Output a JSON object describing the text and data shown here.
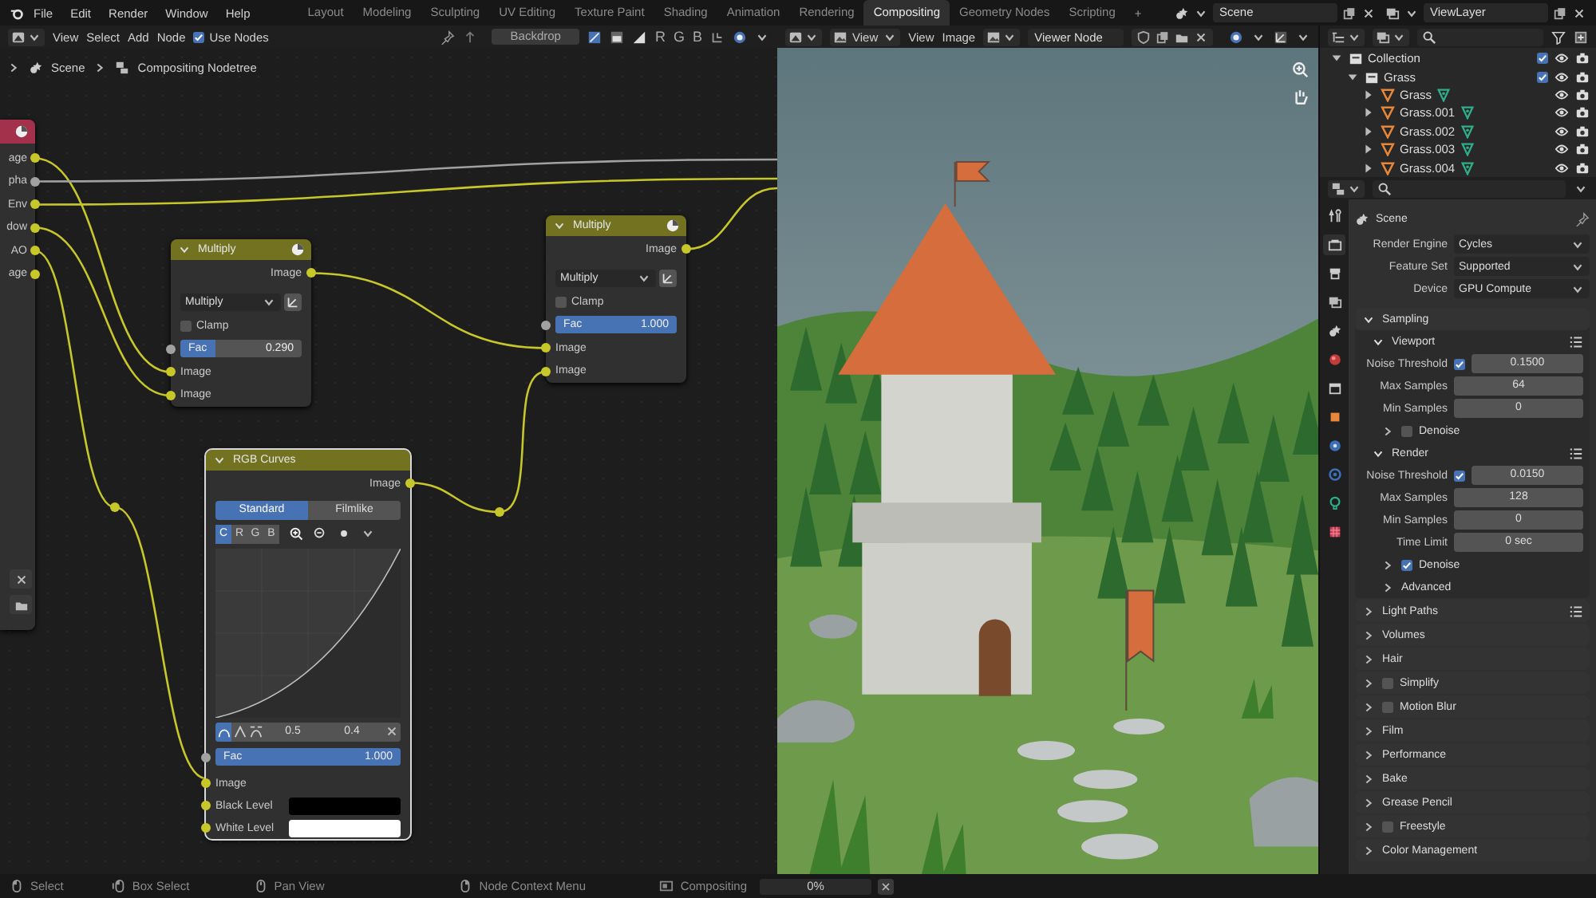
{
  "topbar": {
    "menus": [
      "File",
      "Edit",
      "Render",
      "Window",
      "Help"
    ],
    "workspaces": [
      {
        "label": "Layout",
        "selected": false
      },
      {
        "label": "Modeling",
        "selected": false
      },
      {
        "label": "Sculpting",
        "selected": false
      },
      {
        "label": "UV Editing",
        "selected": false
      },
      {
        "label": "Texture Paint",
        "selected": false
      },
      {
        "label": "Shading",
        "selected": false
      },
      {
        "label": "Animation",
        "selected": false
      },
      {
        "label": "Rendering",
        "selected": false
      },
      {
        "label": "Compositing",
        "selected": true
      },
      {
        "label": "Geometry Nodes",
        "selected": false
      },
      {
        "label": "Scripting",
        "selected": false
      }
    ],
    "add_workspace": "+",
    "scene": "Scene",
    "view_layer": "ViewLayer"
  },
  "node_editor": {
    "menus": [
      "View",
      "Select",
      "Add",
      "Node"
    ],
    "use_nodes": {
      "label": "Use Nodes",
      "checked": true
    },
    "backdrop": "Backdrop",
    "backdrop_channels": [
      "R",
      "G",
      "B"
    ],
    "breadcrumb": [
      "Scene",
      "Compositing Nodetree"
    ],
    "render_layers_node": {
      "sockets": [
        "age",
        "pha",
        "Env",
        "dow",
        "AO",
        "age"
      ]
    },
    "nodes": [
      {
        "kind": "mix",
        "title": "Multiply",
        "output": "Image",
        "blend": "Multiply",
        "clamp": {
          "label": "Clamp",
          "checked": false
        },
        "fac": {
          "label": "Fac",
          "value": "0.290",
          "level": 0.29
        },
        "inputs": [
          "Image",
          "Image"
        ]
      },
      {
        "kind": "mix",
        "title": "Multiply",
        "output": "Image",
        "blend": "Multiply",
        "clamp": {
          "label": "Clamp",
          "checked": false
        },
        "fac": {
          "label": "Fac",
          "value": "1.000",
          "level": 1
        },
        "inputs": [
          "Image",
          "Image"
        ]
      },
      {
        "kind": "curves",
        "title": "RGB Curves",
        "output": "Image",
        "modes": [
          {
            "label": "Standard",
            "selected": true
          },
          {
            "label": "Filmlike",
            "selected": false
          }
        ],
        "channels": [
          {
            "label": "C",
            "selected": true
          },
          {
            "label": "R",
            "selected": false
          },
          {
            "label": "G",
            "selected": false
          },
          {
            "label": "B",
            "selected": false
          }
        ],
        "point": [
          "0.5",
          "0.4"
        ],
        "fac": {
          "label": "Fac",
          "value": "1.000",
          "level": 1
        },
        "inputs": [
          {
            "kind": "socket",
            "label": "Image"
          },
          {
            "kind": "color",
            "label": "Black Level",
            "color": "#000000"
          },
          {
            "kind": "color",
            "label": "White Level",
            "color": "#ffffff"
          }
        ]
      }
    ]
  },
  "image_editor": {
    "view_dropdown": "View",
    "menus": [
      "View",
      "Image"
    ],
    "image": "Viewer Node"
  },
  "outliner": {
    "tree": [
      {
        "kind": "collection",
        "name": "Collection",
        "expanded": true,
        "checked": true,
        "children": [
          {
            "kind": "collection",
            "name": "Grass",
            "expanded": true,
            "checked": true,
            "children": [
              {
                "kind": "object",
                "name": "Grass",
                "expanded": false
              },
              {
                "kind": "object",
                "name": "Grass.001",
                "expanded": false
              },
              {
                "kind": "object",
                "name": "Grass.002",
                "expanded": false
              },
              {
                "kind": "object",
                "name": "Grass.003",
                "expanded": false
              },
              {
                "kind": "object",
                "name": "Grass.004",
                "expanded": false
              }
            ]
          }
        ]
      }
    ]
  },
  "properties": {
    "tabs": [
      {
        "kind": "tool",
        "selected": false
      },
      {
        "kind": "render",
        "selected": true
      },
      {
        "kind": "output",
        "selected": false
      },
      {
        "kind": "view_layer",
        "selected": false
      },
      {
        "kind": "scene",
        "selected": false
      },
      {
        "kind": "world",
        "selected": false
      },
      {
        "kind": "collection",
        "selected": false
      },
      {
        "kind": "object",
        "selected": false
      },
      {
        "kind": "modifier",
        "selected": false
      },
      {
        "kind": "physics",
        "selected": false
      },
      {
        "kind": "data",
        "selected": false
      },
      {
        "kind": "texture",
        "selected": false
      }
    ],
    "context": "Scene",
    "fields": [
      {
        "label": "Render Engine",
        "value": "Cycles"
      },
      {
        "label": "Feature Set",
        "value": "Supported"
      },
      {
        "label": "Device",
        "value": "GPU Compute"
      }
    ],
    "panels": [
      {
        "kind": "panel",
        "title": "Sampling",
        "expanded": true,
        "children": [
          {
            "kind": "panel",
            "title": "Viewport",
            "expanded": true,
            "presets": true,
            "children": [
              {
                "kind": "toggle_number",
                "label": "Noise Threshold",
                "checked": true,
                "value": "0.1500"
              },
              {
                "kind": "number",
                "label": "Max Samples",
                "value": "64"
              },
              {
                "kind": "number",
                "label": "Min Samples",
                "value": "0"
              },
              {
                "kind": "panel",
                "title": "Denoise",
                "expanded": false,
                "checked": false
              }
            ]
          },
          {
            "kind": "panel",
            "title": "Render",
            "expanded": true,
            "presets": true,
            "children": [
              {
                "kind": "toggle_number",
                "label": "Noise Threshold",
                "checked": true,
                "value": "0.0150"
              },
              {
                "kind": "number",
                "label": "Max Samples",
                "value": "128"
              },
              {
                "kind": "number",
                "label": "Min Samples",
                "value": "0"
              },
              {
                "kind": "number",
                "label": "Time Limit",
                "value": "0 sec"
              },
              {
                "kind": "panel",
                "title": "Denoise",
                "expanded": false,
                "checked": true
              },
              {
                "kind": "panel",
                "title": "Advanced",
                "expanded": false
              }
            ]
          }
        ]
      },
      {
        "kind": "panel",
        "title": "Light Paths",
        "expanded": false,
        "presets": true
      },
      {
        "kind": "panel",
        "title": "Volumes",
        "expanded": false
      },
      {
        "kind": "panel",
        "title": "Hair",
        "expanded": false
      },
      {
        "kind": "panel",
        "title": "Simplify",
        "expanded": false,
        "checked": false
      },
      {
        "kind": "panel",
        "title": "Motion Blur",
        "expanded": false,
        "checked": false
      },
      {
        "kind": "panel",
        "title": "Film",
        "expanded": false
      },
      {
        "kind": "panel",
        "title": "Performance",
        "expanded": false
      },
      {
        "kind": "panel",
        "title": "Bake",
        "expanded": false
      },
      {
        "kind": "panel",
        "title": "Grease Pencil",
        "expanded": false
      },
      {
        "kind": "panel",
        "title": "Freestyle",
        "expanded": false,
        "checked": false
      },
      {
        "kind": "panel",
        "title": "Color Management",
        "expanded": false
      }
    ]
  },
  "status_bar": {
    "items": [
      {
        "kind": "mouse_left",
        "label": "Select"
      },
      {
        "kind": "mouse_drag",
        "label": "Box Select"
      },
      {
        "kind": "mouse_middle",
        "label": "Pan View"
      },
      {
        "kind": "mouse_right",
        "label": "Node Context Menu"
      }
    ],
    "job": "Compositing",
    "progress": {
      "label": "0%",
      "level": 0
    }
  }
}
